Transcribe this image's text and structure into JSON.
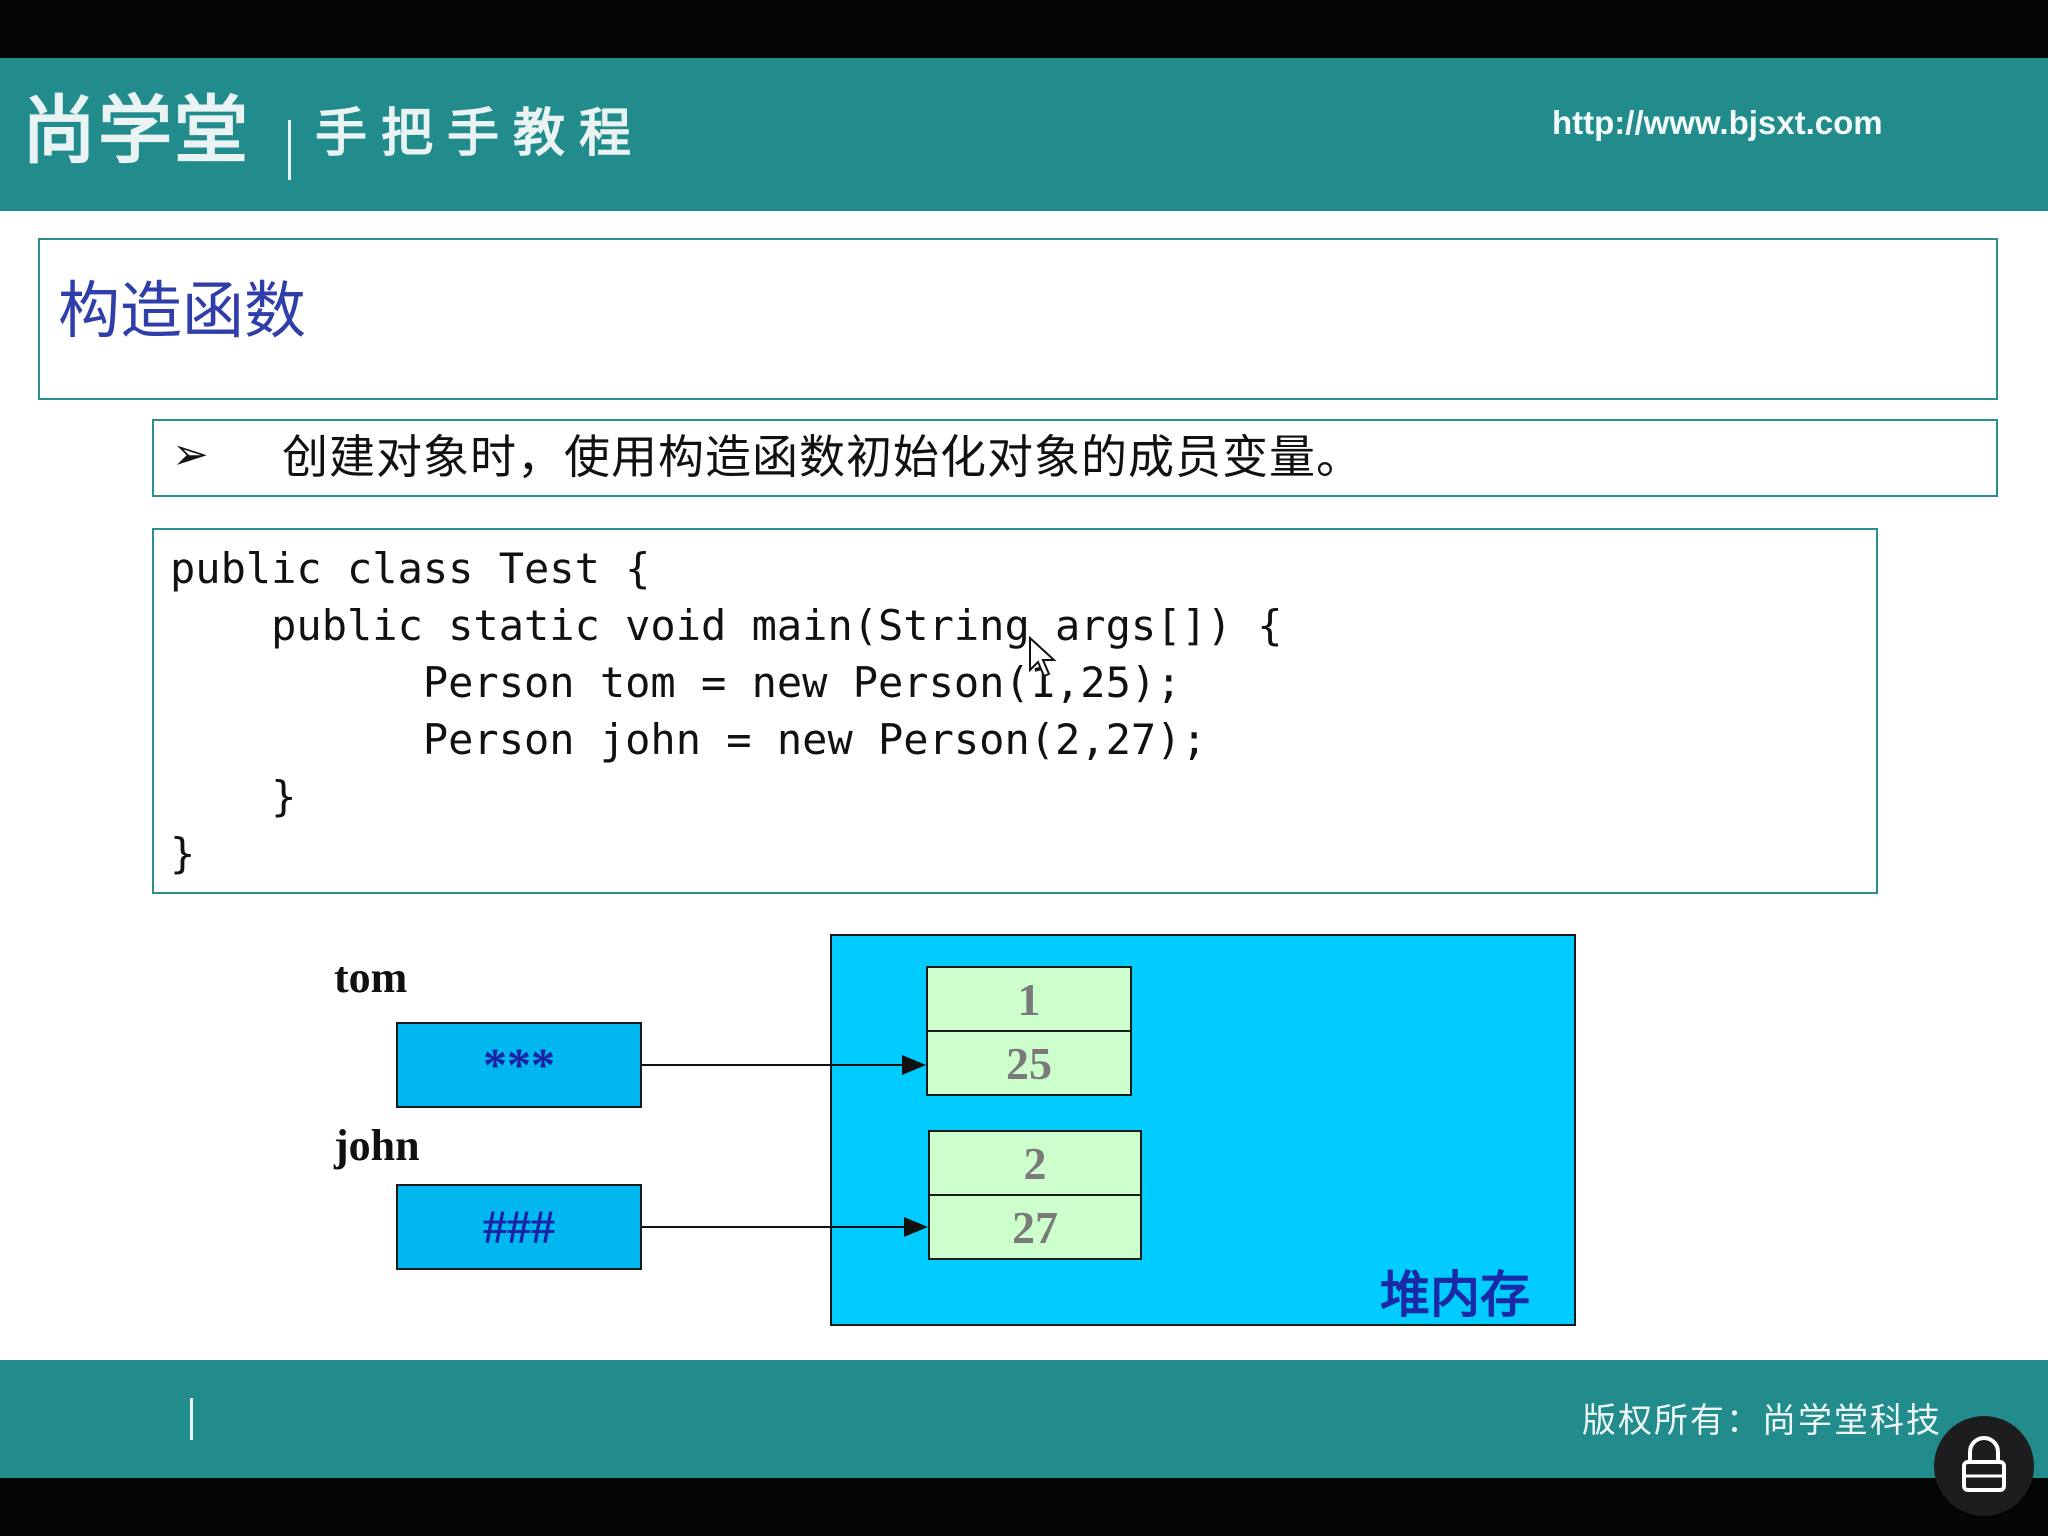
{
  "header": {
    "logo": "尚学堂",
    "subtitle": "手把手教程",
    "url": "http://www.bjsxt.com"
  },
  "slide": {
    "title": "构造函数",
    "bullet": "创建对象时，使用构造函数初始化对象的成员变量。",
    "bullet_marker": "➢",
    "code": [
      "public class Test {",
      "    public static void main(String args[]) {",
      "          Person tom = new Person(1,25);",
      "          Person john = new Person(2,27);",
      "    }",
      "}"
    ]
  },
  "diagram": {
    "tom_label": "tom",
    "tom_ref": "***",
    "john_label": "john",
    "john_ref": "###",
    "heap_label": "堆内存",
    "obj1": [
      "1",
      "25"
    ],
    "obj2": [
      "2",
      "27"
    ]
  },
  "footer": {
    "copyright": "版权所有：尚学堂科技"
  },
  "icons": {
    "lock": "lock-icon",
    "cursor": "mouse-cursor-icon"
  }
}
